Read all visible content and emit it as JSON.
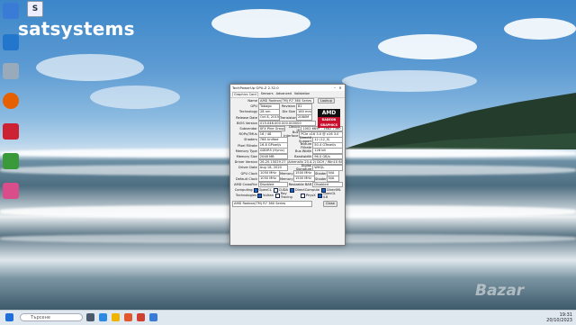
{
  "watermark": {
    "text": "satsystems",
    "logo_text": "S"
  },
  "desktop_icons": [
    {
      "name": "network",
      "label": "",
      "color": "#3a7bd5"
    },
    {
      "name": "app-blue",
      "label": "",
      "color": "#2277cc"
    },
    {
      "name": "recycle-bin",
      "label": "",
      "color": "#99aabb"
    },
    {
      "name": "firefox",
      "label": "",
      "color": "#e66000"
    },
    {
      "name": "cpuid",
      "label": "",
      "color": "#cc2233"
    },
    {
      "name": "app-green",
      "label": "",
      "color": "#3a9a3a"
    },
    {
      "name": "app-pink",
      "label": "",
      "color": "#d84d8a"
    }
  ],
  "window": {
    "title": "TechPowerUp GPU-Z 2.32.0",
    "tabs": [
      "Graphics Card",
      "Sensors",
      "Advanced",
      "Validation"
    ],
    "fields": {
      "name": {
        "label": "Name",
        "value": "AMD Radeon(TM) R7 360 Series",
        "button": "Lookup"
      },
      "gpu": {
        "label": "GPU",
        "value": "Tobago",
        "label2": "Revision",
        "value2": "81"
      },
      "technology": {
        "label": "Technology",
        "value": "28 nm",
        "label2": "Die Size",
        "value2": "160 mm²"
      },
      "release": {
        "label": "Release Date",
        "value": "Oct 8, 2015",
        "label2": "Transistors",
        "value2": "2080M"
      },
      "bios": {
        "label": "BIOS Version",
        "value": "015.046.000.000.000000",
        "uefi": "UEFI"
      },
      "subvendor": {
        "label": "Subvendor",
        "value": "XFX Pine Group",
        "label2": "Device ID",
        "value2": "1002 665F - 1682 7360"
      },
      "rops": {
        "label": "ROPs/TMUs",
        "value": "16 / 48",
        "label2": "Bus Interface",
        "value2": "PCIe x16 3.0 @ x16 3.0"
      },
      "shaders": {
        "label": "Shaders",
        "value": "768 Unified",
        "label2": "DirectX Support",
        "value2": "12 (12_0)"
      },
      "pixel": {
        "label": "Pixel Fillrate",
        "value": "16.8 GPixel/s",
        "label2": "Texture Fillrate",
        "value2": "50.4 GTexel/s"
      },
      "memtype": {
        "label": "Memory Type",
        "value": "GDDR5 (Hynix)",
        "label2": "Bus Width",
        "value2": "128 bit"
      },
      "memsize": {
        "label": "Memory Size",
        "value": "2048 MB",
        "label2": "Bandwidth",
        "value2": "96.0 GB/s"
      },
      "driver": {
        "label": "Driver Version",
        "value": "26.20.15029.27 (Adrenalin 20.4.2) DCH / Win10 64"
      },
      "driverdate": {
        "label": "Driver Date",
        "value": "Aug 18, 2020",
        "label2": "Digital Signature",
        "value2": "WHQL"
      },
      "gpuclock": {
        "label": "GPU Clock",
        "value": "1050 MHz",
        "label2": "Memory",
        "value2": "1500 MHz",
        "label3": "Shader",
        "value3": "N/A"
      },
      "defclock": {
        "label": "Default Clock",
        "value": "1050 MHz",
        "label2": "Memory",
        "value2": "1500 MHz",
        "label3": "Shader",
        "value3": "N/A"
      },
      "crossfire": {
        "label": "AMD CrossFire",
        "value": "Disabled",
        "label2": "Resizable BAR",
        "value2": "Disabled"
      },
      "computing": {
        "label": "Computing",
        "items": [
          "OpenCL",
          "CUDA",
          "DirectCompute",
          "DirectML"
        ]
      },
      "technologies": {
        "label": "Technologies",
        "items": [
          "Vulkan",
          "Ray Tracing",
          "PhysX",
          "OpenGL 4.6"
        ]
      }
    },
    "footer_select": "AMD Radeon(TM) R7 360 Series",
    "close_label": "Close",
    "logo": {
      "brand": "AMD",
      "sub": "RADEON GRAPHICS"
    }
  },
  "taskbar": {
    "search_placeholder": "Търсене",
    "clock_time": "19:31",
    "clock_date": "20/10/2023"
  },
  "bazar": "Bazar"
}
